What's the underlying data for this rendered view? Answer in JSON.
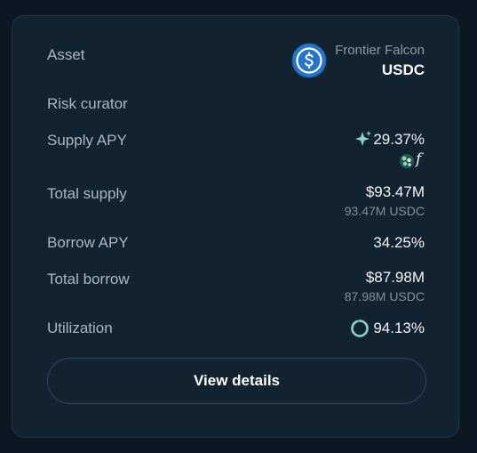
{
  "asset": {
    "label": "Asset",
    "curator_name": "Frontier Falcon",
    "symbol": "USDC",
    "icon": "usdc-coin-icon"
  },
  "risk_curator": {
    "label": "Risk curator"
  },
  "supply_apy": {
    "label": "Supply APY",
    "value": "29.37%",
    "icon": "sparkle-icon",
    "reward_icons": [
      "reward-token-icon",
      "f-token-icon"
    ],
    "reward_text": "f"
  },
  "total_supply": {
    "label": "Total supply",
    "value": "$93.47M",
    "sub_value": "93.47M USDC"
  },
  "borrow_apy": {
    "label": "Borrow APY",
    "value": "34.25%"
  },
  "total_borrow": {
    "label": "Total borrow",
    "value": "$87.98M",
    "sub_value": "87.98M USDC"
  },
  "utilization": {
    "label": "Utilization",
    "value": "94.13%",
    "fraction": 0.9413
  },
  "view_details_label": "View details",
  "colors": {
    "background": "#0c1822",
    "card": "#112331",
    "usdc_blue": "#2775ca",
    "accent_teal": "#8fd0cc"
  }
}
